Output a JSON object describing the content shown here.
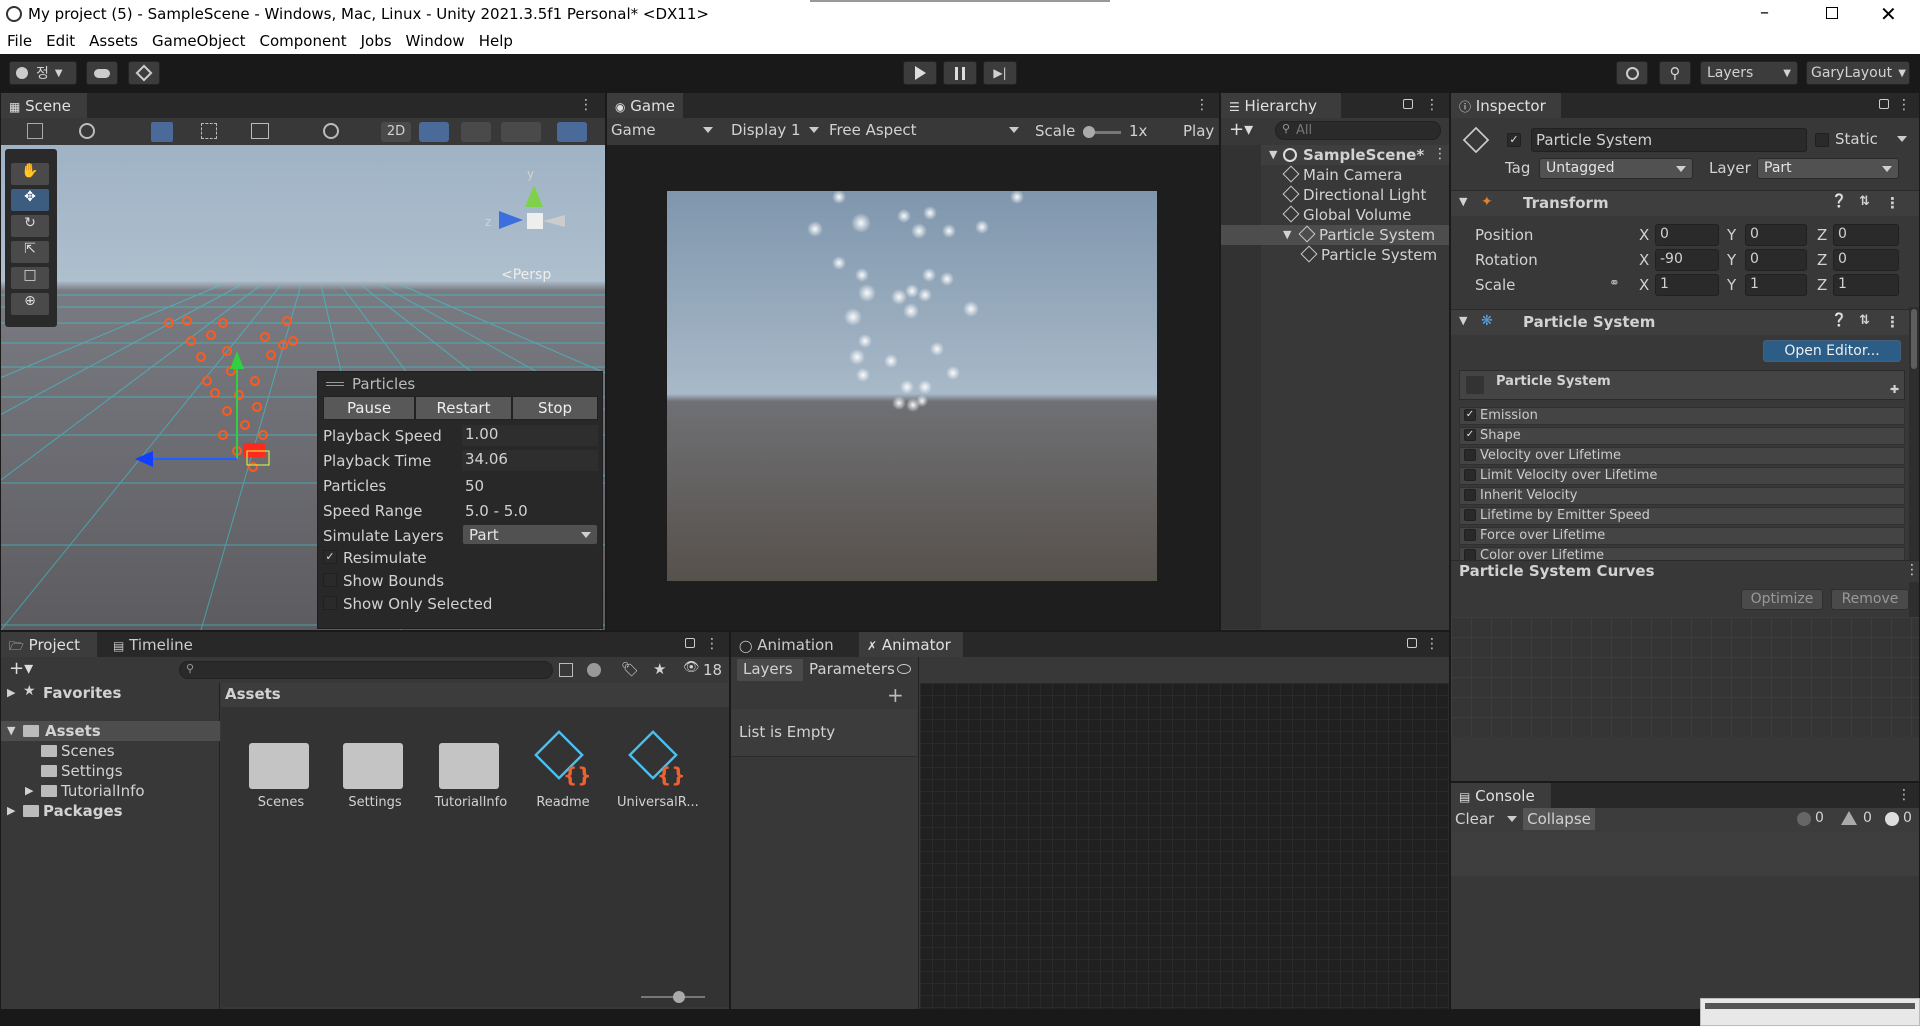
{
  "window": {
    "title": "My project (5) - SampleScene - Windows, Mac, Linux - Unity 2021.3.5f1 Personal* <DX11>"
  },
  "menu": [
    "File",
    "Edit",
    "Assets",
    "GameObject",
    "Component",
    "Jobs",
    "Window",
    "Help"
  ],
  "toolbar": {
    "account_label": "정",
    "layers": "Layers",
    "layout": "GaryLayout"
  },
  "scene": {
    "tab": "Scene",
    "mode_2d": "2D",
    "persp": "<Persp",
    "axis_y": "y",
    "axis_z": "z"
  },
  "particles_overlay": {
    "title": "Particles",
    "pause": "Pause",
    "restart": "Restart",
    "stop": "Stop",
    "rows": [
      {
        "label": "Playback Speed",
        "value": "1.00"
      },
      {
        "label": "Playback Time",
        "value": "34.06"
      },
      {
        "label": "Particles",
        "value": "50"
      },
      {
        "label": "Speed Range",
        "value": "5.0 - 5.0"
      }
    ],
    "simulate_layers_label": "Simulate Layers",
    "simulate_layers_value": "Part",
    "resimulate": "Resimulate",
    "show_bounds": "Show Bounds",
    "show_only_selected": "Show Only Selected"
  },
  "game": {
    "tab": "Game",
    "mode": "Game",
    "display": "Display 1",
    "aspect": "Free Aspect",
    "scale_label": "Scale",
    "scale_value": "1x",
    "play": "Play"
  },
  "hierarchy": {
    "tab": "Hierarchy",
    "search_placeholder": "All",
    "items": [
      "SampleScene*",
      "Main Camera",
      "Directional Light",
      "Global Volume",
      "Particle System",
      "Particle System"
    ]
  },
  "inspector": {
    "tab": "Inspector",
    "object_name": "Particle System",
    "static": "Static",
    "tag_label": "Tag",
    "tag_value": "Untagged",
    "layer_label": "Layer",
    "layer_value": "Part",
    "transform": "Transform",
    "position": {
      "label": "Position",
      "x": "0",
      "y": "0",
      "z": "0"
    },
    "rotation": {
      "label": "Rotation",
      "x": "-90",
      "y": "0",
      "z": "0"
    },
    "scale": {
      "label": "Scale",
      "x": "1",
      "y": "1",
      "z": "1"
    },
    "axis": {
      "x": "X",
      "y": "Y",
      "z": "Z"
    },
    "particle_system": "Particle System",
    "open_editor": "Open Editor...",
    "ps_header": "Particle System",
    "modules": [
      {
        "label": "Emission",
        "checked": true
      },
      {
        "label": "Shape",
        "checked": true
      },
      {
        "label": "Velocity over Lifetime",
        "checked": false
      },
      {
        "label": "Limit Velocity over Lifetime",
        "checked": false
      },
      {
        "label": "Inherit Velocity",
        "checked": false
      },
      {
        "label": "Lifetime by Emitter Speed",
        "checked": false
      },
      {
        "label": "Force over Lifetime",
        "checked": false
      },
      {
        "label": "Color over Lifetime",
        "checked": false
      }
    ],
    "curves": "Particle System Curves",
    "optimize": "Optimize",
    "remove": "Remove"
  },
  "project": {
    "tab_project": "Project",
    "tab_timeline": "Timeline",
    "count": "18",
    "tree": {
      "favorites": "Favorites",
      "assets": "Assets",
      "scenes": "Scenes",
      "settings": "Settings",
      "tutorialinfo": "TutorialInfo",
      "packages": "Packages"
    },
    "breadcrumb": "Assets",
    "items": [
      "Scenes",
      "Settings",
      "TutorialInfo",
      "Readme",
      "UniversalR..."
    ]
  },
  "animator": {
    "tab_animation": "Animation",
    "tab_animator": "Animator",
    "layers": "Layers",
    "parameters": "Parameters",
    "empty": "List is Empty"
  },
  "console": {
    "tab": "Console",
    "clear": "Clear",
    "collapse": "Collapse",
    "info": "0",
    "warn": "0",
    "error": "0"
  },
  "colors": {
    "accent": "#2c5d87",
    "selection": "#2c5d87",
    "bg": "#383838",
    "particle_handle": "#ff5a1e"
  }
}
